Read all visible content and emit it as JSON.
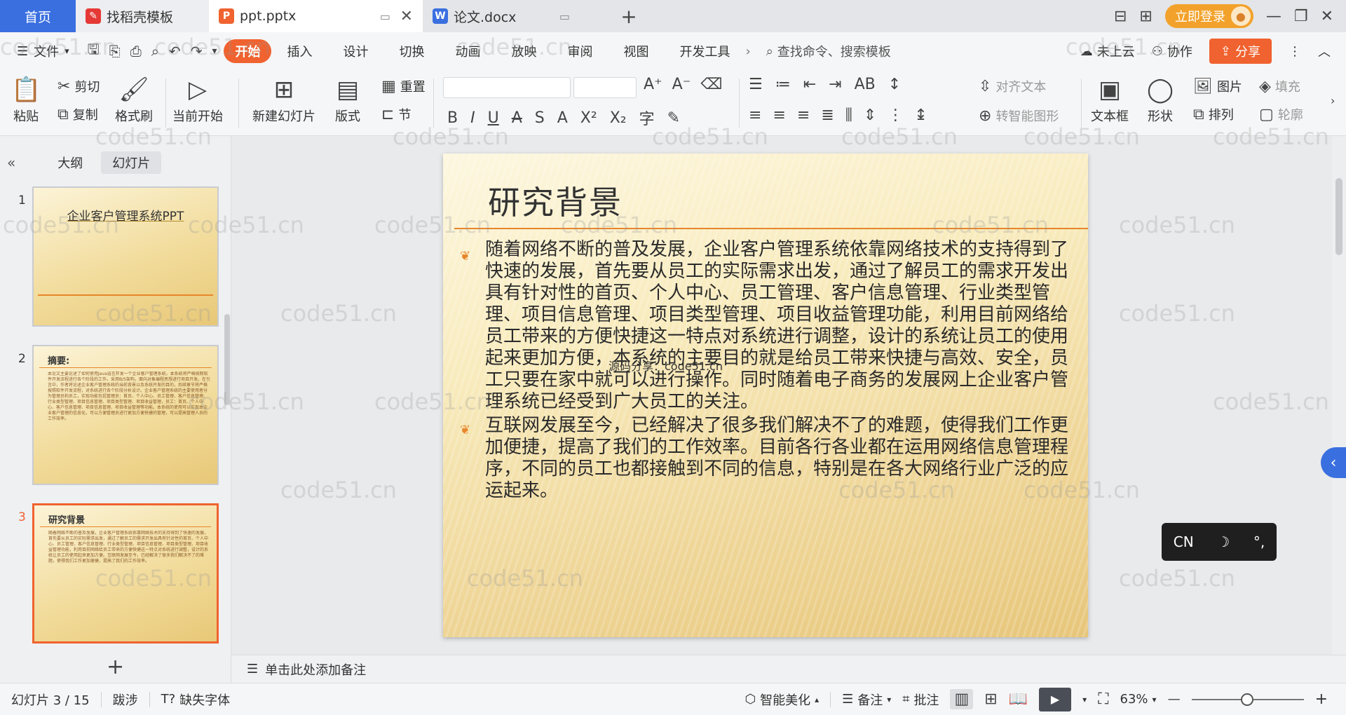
{
  "tabs": {
    "home": "首页",
    "template": "找稻壳模板",
    "ppt": "ppt.pptx",
    "word": "论文.docx",
    "login": "立即登录"
  },
  "menu": {
    "file": "文件",
    "tabs": [
      "开始",
      "插入",
      "设计",
      "切换",
      "动画",
      "放映",
      "审阅",
      "视图",
      "开发工具"
    ],
    "search_placeholder": "查找命令、搜索模板",
    "cloud": "未上云",
    "collab": "协作",
    "share": "分享"
  },
  "ribbon": {
    "paste": "粘贴",
    "cut": "剪切",
    "copy": "复制",
    "format_painter": "格式刷",
    "from_current": "当前开始",
    "new_slide": "新建幻灯片",
    "layout": "版式",
    "reset": "重置",
    "section": "节",
    "align_text": "对齐文本",
    "smart_shape": "转智能图形",
    "textbox": "文本框",
    "shape": "形状",
    "picture": "图片",
    "fill": "填充",
    "arrange": "排列",
    "outline": "轮廓"
  },
  "left_panel": {
    "tab_outline": "大纲",
    "tab_slides": "幻灯片",
    "thumbs": [
      {
        "num": "1",
        "title": "企业客户管理系统PPT"
      },
      {
        "num": "2",
        "title": "摘要:",
        "body": "本论文主要论述了如何使用Java语言开发一个企业客户管理系统，本系统将严格按照软件开发流程进行各个阶段的工作。采用B/S架构，面向对象编程思想进行项目开发。在引言中，作者将论述企业客户管理系统的当前背景以及系统开发的目的，后续章节将严格按照软件开发流程，对系统进行各个阶段分析设计。企业客户管理系统的主要使用者分为管理员和员工，实现功能包括管理员：首页、个人中心、员工管理、客户信息管理、行业类型管理、项目信息管理、项目类型管理、项目收益管理，员工：首页、个人中心、客户信息管理、项目信息管理、项目收益管理等功能。本系统的使用可以实现本企业客户管理的信息化，可以方便管理员进行更加方便快捷的管理，可以提高管理人员的工作效率。"
      },
      {
        "num": "3",
        "title": "研究背景",
        "body": "随着网络不断的普及发展，企业客户管理系统依靠网络技术的支持得到了快速的发展，首先要从员工的实际需求出发，通过了解员工的需求开发出具有针对性的首页、个人中心、员工管理、客户信息管理、行业类型管理、项目信息管理、项目类型管理、项目收益管理功能，利用目前网络给员工带来的方便快捷这一特点对系统进行调整，设计的系统让员工的使用起来更加方便。互联网发展至今，已经解决了很多我们解决不了的难题，使得我们工作更加便捷，提高了我们的工作效率。"
      }
    ]
  },
  "slide": {
    "title": "研究背景",
    "paragraphs": [
      " 随着网络不断的普及发展，企业客户管理系统依靠网络技术的支持得到了快速的发展，首先要从员工的实际需求出发，通过了解员工的需求开发出具有针对性的首页、个人中心、员工管理、客户信息管理、行业类型管理、项目信息管理、项目类型管理、项目收益管理功能，利用目前网络给员工带来的方便快捷这一特点对系统进行调整，设计的系统让员工的使用起来更加方便，本系统的主要目的就是给员工带来快捷与高效、安全，员工只要在家中就可以进行操作。同时随着电子商务的发展网上企业客户管理系统已经受到广大员工的关注。",
      "互联网发展至今，已经解决了很多我们解决不了的难题，使得我们工作更加便捷，提高了我们的工作效率。目前各行各业都在运用网络信息管理程序，不同的员工也都接触到不同的信息，特别是在各大网络行业广泛的应运起来。"
    ],
    "overlay_label": "源码分享：code51.cn"
  },
  "ime": {
    "lang": "CN"
  },
  "notes_placeholder": "单击此处添加备注",
  "status": {
    "slide_counter": "幻灯片 3 / 15",
    "theme": "跋涉",
    "missing_font": "缺失字体",
    "beautify": "智能美化",
    "notes": "备注",
    "comments": "批注",
    "zoom": "63%"
  },
  "watermark": "code51.cn",
  "colors": {
    "accent": "#f0622f",
    "home_tab": "#3a6fe0",
    "login": "#f2a22b",
    "rule": "#e7862a"
  }
}
